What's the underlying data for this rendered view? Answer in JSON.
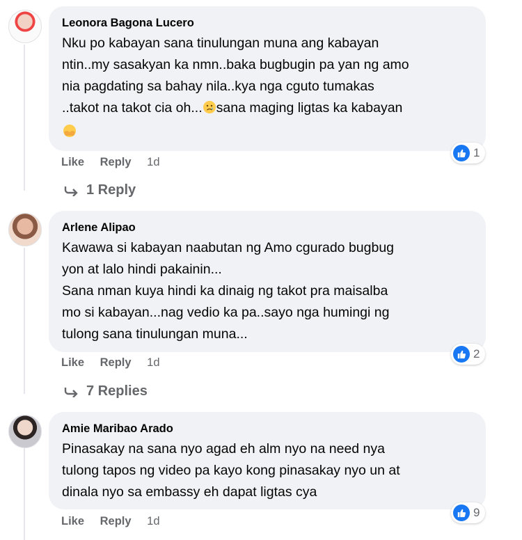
{
  "actions": {
    "like_label": "Like",
    "reply_label": "Reply"
  },
  "comments": [
    {
      "author": "Leonora Bagona Lucero",
      "text": "Nku po kabayan sana tinulungan muna ang kabayan\nntin..my sasakyan ka nmn..baka bugbugin pa yan ng amo\nnia pagdating sa bahay nila..kya nga cguto tumakas\n..takot na takot cia oh...",
      "text_after_emoji": "sana maging ligtas ka kabayan",
      "time": "1d",
      "reaction_count": "1",
      "replies_label": "1 Reply"
    },
    {
      "author": "Arlene Alipao",
      "text": "Kawawa si kabayan naabutan ng Amo cgurado bugbug\nyon at lalo hindi pakainin...\nSana nman kuya hindi ka dinaig ng takot pra maisalba\nmo si kabayan...nag vedio ka pa..sayo nga humingi ng\ntulong sana tinulungan muna...",
      "time": "1d",
      "reaction_count": "2",
      "replies_label": "7 Replies"
    },
    {
      "author": "Amie Maribao Arado",
      "text": "Pinasakay na sana nyo agad eh alm nyo na need nya\ntulong tapos ng video pa kayo kong pinasakay nyo un at\ndinala nyo sa embassy eh dapat ligtas cya",
      "time": "1d",
      "reaction_count": "9"
    }
  ],
  "colors": {
    "bubble": "#f0f2f5",
    "like_blue": "#1877f2",
    "muted": "#65676b"
  },
  "icons": {
    "reaction": "like-icon",
    "reply_arrow": "reply-arrow-icon",
    "emoji_1": "crying-face-icon",
    "emoji_2": "hug-hands-icon"
  }
}
